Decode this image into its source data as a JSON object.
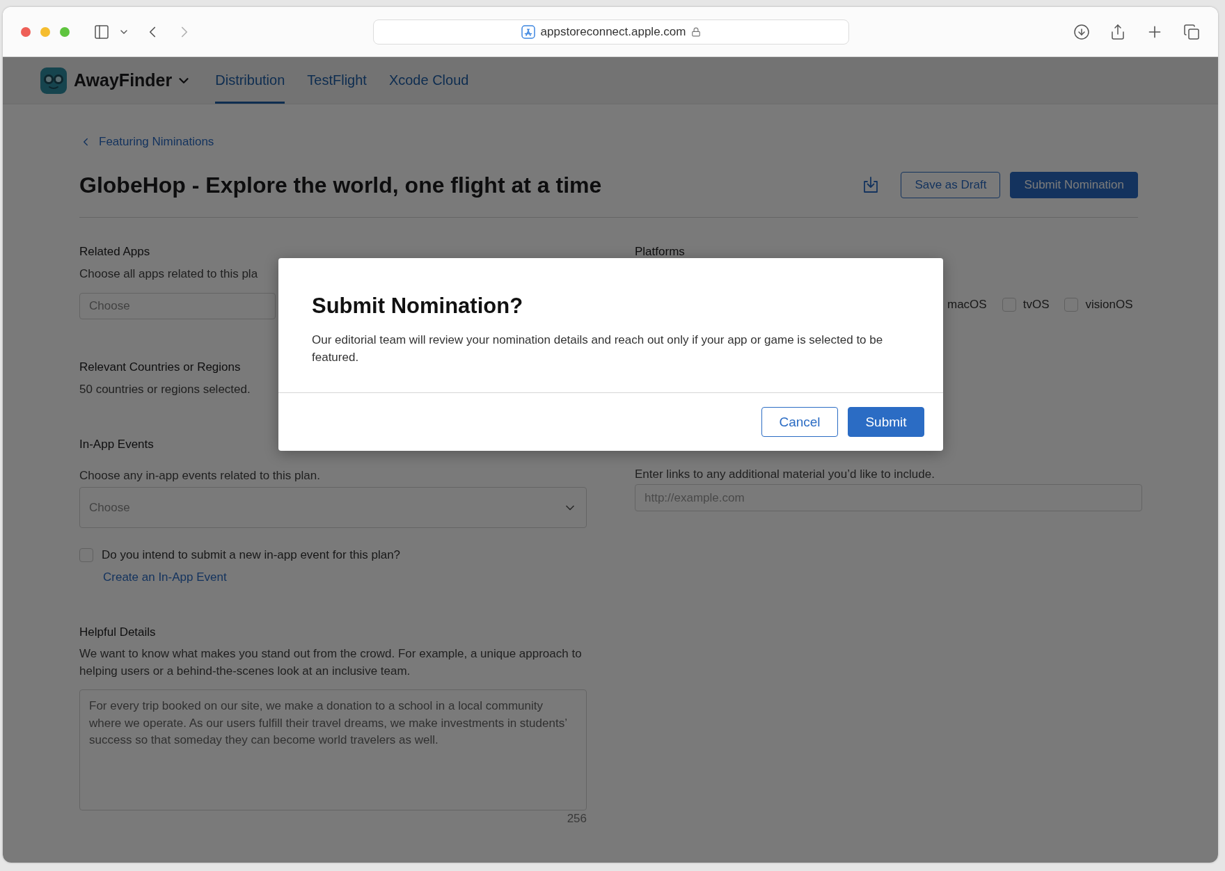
{
  "browser": {
    "url": "appstoreconnect.apple.com"
  },
  "app": {
    "name": "AwayFinder"
  },
  "tabs": [
    {
      "label": "Distribution",
      "selected": true
    },
    {
      "label": "TestFlight",
      "selected": false
    },
    {
      "label": "Xcode Cloud",
      "selected": false
    }
  ],
  "breadcrumb": "Featuring Niminations",
  "title": "GlobeHop - Explore the world, one flight at a time",
  "actions": [
    {
      "label": "Save as Draft",
      "kind": "secondary"
    },
    {
      "label": "Submit Nomination",
      "kind": "primary"
    }
  ],
  "related_apps": {
    "label": "Related Apps",
    "hint": "Choose all apps related to this pla",
    "placeholder": "Choose"
  },
  "countries": {
    "label": "Relevant Countries or Regions",
    "summary": "50 countries or regions selected."
  },
  "in_app_events": {
    "label": "In-App Events",
    "hint": "Choose any in-app events related to this plan.",
    "placeholder": "Choose",
    "new_event": {
      "label": "Do you intend to submit a new in-app event for this plan?",
      "checked": false
    },
    "link": "Create an In-App Event"
  },
  "helpful_details": {
    "label": "Helpful Details",
    "hint": "We want to know what makes you stand out from the crowd. For example, a unique approach to helping users or a behind-the-scenes look at an inclusive team.",
    "value": "For every trip booked on our site, we make a donation to a school in a local community where we operate. As our users fulfill their travel dreams, we make investments in students’ success so that someday they can become world travelers as well.",
    "counter": "256"
  },
  "platforms": {
    "label": "Platforms",
    "items": [
      {
        "label": "macOS"
      },
      {
        "label": "tvOS",
        "checked": false
      },
      {
        "label": "visionOS",
        "checked": false
      }
    ]
  },
  "links": {
    "hint": "Enter links to any additional material you’d like to include.",
    "placeholder": "http://example.com"
  },
  "modal": {
    "title": "Submit Nomination?",
    "body": "Our editorial team will review your nomination details and reach out only if your app or game is selected to be featured.",
    "buttons": [
      {
        "label": "Cancel",
        "kind": "secondary"
      },
      {
        "label": "Submit",
        "kind": "primary"
      }
    ]
  }
}
